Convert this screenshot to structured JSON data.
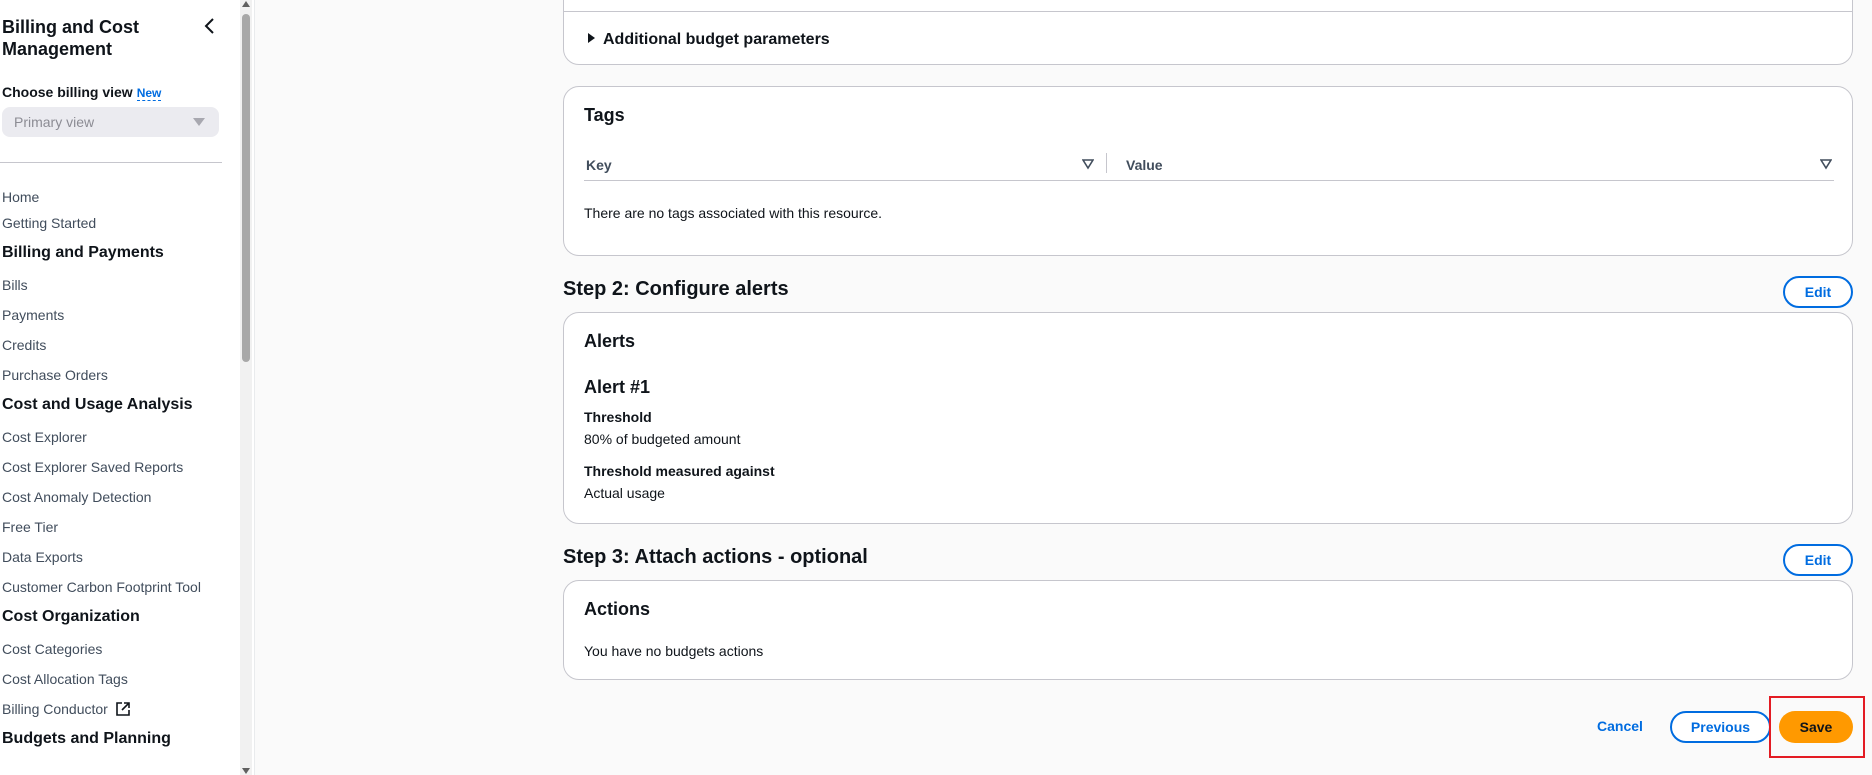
{
  "sidebar": {
    "title": "Billing and Cost Management",
    "billing_view_label": "Choose billing view",
    "billing_view_badge": "New",
    "billing_view_selected": "Primary view",
    "links_top": [
      "Home",
      "Getting Started"
    ],
    "section_billing": "Billing and Payments",
    "links_billing": [
      "Bills",
      "Payments",
      "Credits",
      "Purchase Orders"
    ],
    "section_cost_usage": "Cost and Usage Analysis",
    "links_cost_usage": [
      "Cost Explorer",
      "Cost Explorer Saved Reports",
      "Cost Anomaly Detection",
      "Free Tier",
      "Data Exports",
      "Customer Carbon Footprint Tool"
    ],
    "section_cost_org": "Cost Organization",
    "links_cost_org": [
      "Cost Categories",
      "Cost Allocation Tags",
      "Billing Conductor"
    ],
    "section_budgets": "Budgets and Planning"
  },
  "main": {
    "additional_params": "Additional budget parameters",
    "tags": {
      "title": "Tags",
      "col_key": "Key",
      "col_value": "Value",
      "empty": "There are no tags associated with this resource."
    },
    "step2": {
      "title": "Step 2: Configure alerts",
      "edit": "Edit",
      "card_title": "Alerts",
      "alert_title": "Alert #1",
      "threshold_label": "Threshold",
      "threshold_value": "80% of budgeted amount",
      "measured_label": "Threshold measured against",
      "measured_value": "Actual usage"
    },
    "step3": {
      "title": "Step 3: Attach actions - optional",
      "edit": "Edit",
      "card_title": "Actions",
      "empty": "You have no budgets actions"
    },
    "footer": {
      "cancel": "Cancel",
      "previous": "Previous",
      "save": "Save"
    }
  },
  "colors": {
    "primary_button": "#ff9900",
    "link_blue": "#006ce0",
    "highlight": "#e31b23"
  }
}
